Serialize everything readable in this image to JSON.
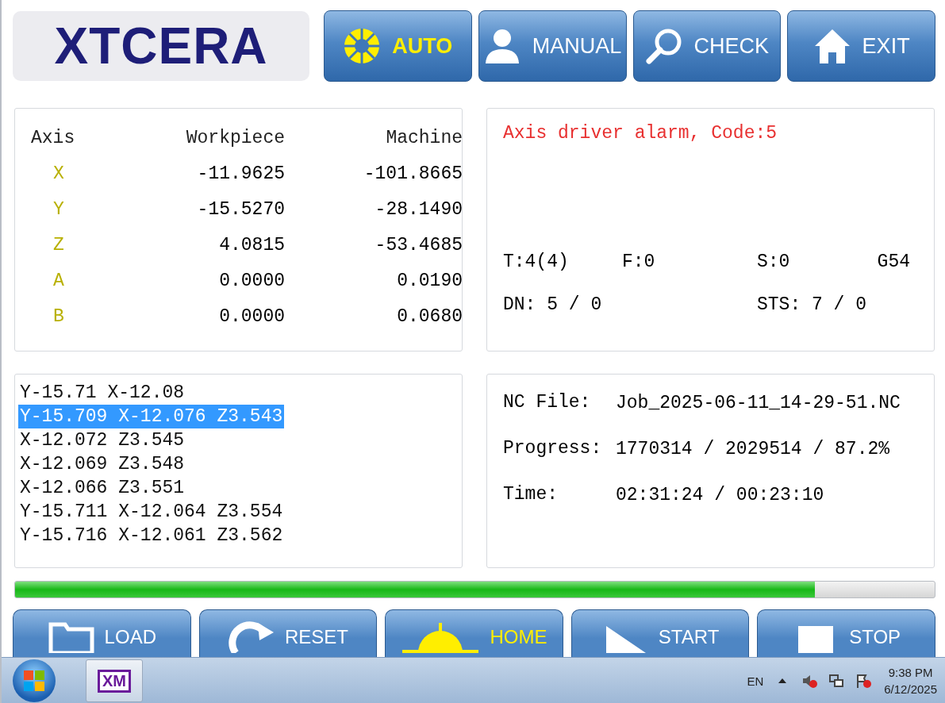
{
  "logo": "XTCERA",
  "top_buttons": [
    {
      "label": "AUTO",
      "kind": "sun",
      "selected": true
    },
    {
      "label": "MANUAL",
      "kind": "person",
      "selected": false
    },
    {
      "label": "CHECK",
      "kind": "search",
      "selected": false
    },
    {
      "label": "EXIT",
      "kind": "house",
      "selected": false
    }
  ],
  "position_table": {
    "columns": [
      "Axis",
      "Workpiece",
      "Machine"
    ],
    "rows": [
      {
        "axis": "X",
        "workpiece": "-11.9625",
        "machine": "-101.8665"
      },
      {
        "axis": "Y",
        "workpiece": "-15.5270",
        "machine": "-28.1490"
      },
      {
        "axis": "Z",
        "workpiece": "4.0815",
        "machine": "-53.4685"
      },
      {
        "axis": "A",
        "workpiece": "0.0000",
        "machine": "0.0190"
      },
      {
        "axis": "B",
        "workpiece": "0.0000",
        "machine": "0.0680"
      }
    ]
  },
  "status": {
    "alarm": "Axis driver alarm, Code:5",
    "tool": "T:4(4)",
    "feed": "F:0",
    "spindle": "S:0",
    "coordinate_system": "G54",
    "dn": "DN: 5 / 0",
    "sts": "STS: 7 / 0"
  },
  "program_lines": [
    {
      "text": "Y-15.71 X-12.08",
      "selected": false
    },
    {
      "text": "Y-15.709 X-12.076 Z3.543",
      "selected": true
    },
    {
      "text": "X-12.072 Z3.545",
      "selected": false
    },
    {
      "text": "X-12.069 Z3.548",
      "selected": false
    },
    {
      "text": "X-12.066 Z3.551",
      "selected": false
    },
    {
      "text": "Y-15.711 X-12.064 Z3.554",
      "selected": false
    },
    {
      "text": "Y-15.716 X-12.061 Z3.562",
      "selected": false
    }
  ],
  "job_info": [
    {
      "label": "NC File:",
      "value": "Job_2025-06-11_14-29-51.NC"
    },
    {
      "label": "Progress:",
      "value": "1770314 / 2029514 / 87.2%"
    },
    {
      "label": "Time:",
      "value": "02:31:24 / 00:23:10"
    }
  ],
  "progress": {
    "level": 0.87
  },
  "bottom_buttons": [
    {
      "label": "LOAD",
      "kind": "folder",
      "highlight": false
    },
    {
      "label": "RESET",
      "kind": "refresh",
      "highlight": false
    },
    {
      "label": "HOME",
      "kind": "target",
      "highlight": true
    },
    {
      "label": "START",
      "kind": "play",
      "highlight": false
    },
    {
      "label": "STOP",
      "kind": "stop",
      "highlight": false
    }
  ],
  "taskbar": {
    "app_icon": "XM",
    "language": "EN",
    "time": "9:38 PM",
    "date": "6/12/2025"
  }
}
